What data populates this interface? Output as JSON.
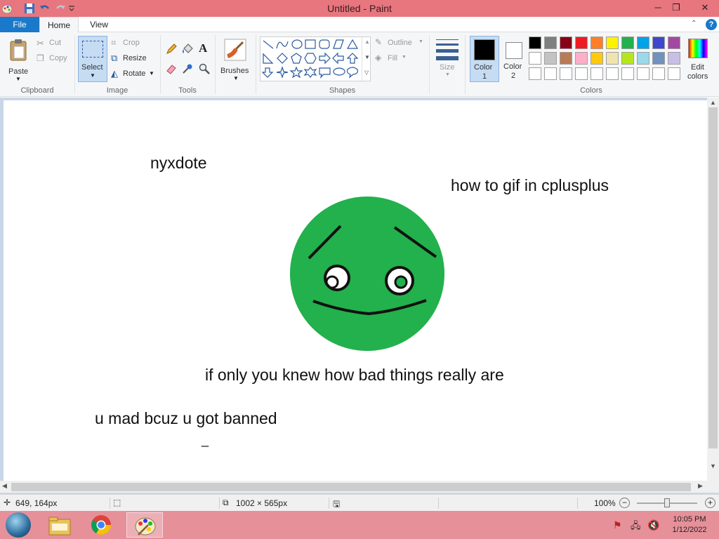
{
  "window": {
    "title": "Untitled - Paint",
    "minimize": "─",
    "restore": "❐",
    "close": "✕"
  },
  "tabs": {
    "file": "File",
    "home": "Home",
    "view": "View",
    "help": "?"
  },
  "ribbon": {
    "clipboard": {
      "paste": "Paste",
      "cut": "Cut",
      "copy": "Copy",
      "group": "Clipboard"
    },
    "image": {
      "select": "Select",
      "crop": "Crop",
      "resize": "Resize",
      "rotate": "Rotate",
      "group": "Image"
    },
    "tools": {
      "group": "Tools",
      "text_tool": "A"
    },
    "brushes": {
      "label": "Brushes"
    },
    "shapes": {
      "outline": "Outline",
      "fill": "Fill",
      "group": "Shapes"
    },
    "size": {
      "label": "Size"
    },
    "color1": {
      "label_line1": "Color",
      "label_line2": "1",
      "value": "#000000"
    },
    "color2": {
      "label_line1": "Color",
      "label_line2": "2",
      "value": "#ffffff"
    },
    "colors": {
      "group": "Colors",
      "edit_line1": "Edit",
      "edit_line2": "colors"
    },
    "palette_row1": [
      "#000000",
      "#7f7f7f",
      "#880015",
      "#ed1c24",
      "#ff7f27",
      "#fff200",
      "#22b14c",
      "#00a2e8",
      "#3f48cc",
      "#a349a4"
    ],
    "palette_row2": [
      "#ffffff",
      "#c3c3c3",
      "#b97a57",
      "#ffaec9",
      "#ffc90e",
      "#efe4b0",
      "#b5e61d",
      "#99d9ea",
      "#7092be",
      "#c8bfe7"
    ],
    "palette_row3": [
      "#ffffff",
      "#ffffff",
      "#ffffff",
      "#ffffff",
      "#ffffff",
      "#ffffff",
      "#ffffff",
      "#ffffff",
      "#ffffff",
      "#ffffff"
    ]
  },
  "canvas": {
    "texts": {
      "t1": "nyxdote",
      "t2": "how to gif in cplusplus",
      "t3": "if only you knew how bad things really are",
      "t4": "u mad bcuz u got banned",
      "cursor": "_"
    },
    "face_color": "#22b14c"
  },
  "status": {
    "cursor_pos": "649, 164px",
    "canvas_size": "1002 × 565px",
    "zoom": "100%"
  },
  "taskbar": {
    "time": "10:05 PM",
    "date": "1/12/2022"
  }
}
